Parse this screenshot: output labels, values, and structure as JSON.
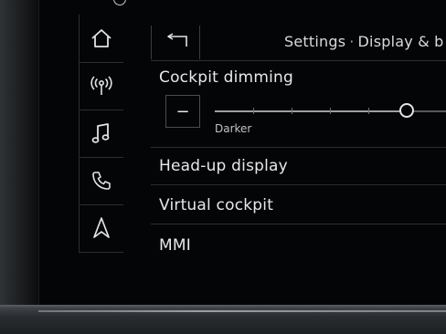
{
  "header": {
    "back_icon": "back-arrow-icon",
    "breadcrumb_root": "Settings",
    "breadcrumb_separator": "·",
    "breadcrumb_current": "Display & b"
  },
  "sidebar": {
    "items": [
      {
        "icon": "home-icon"
      },
      {
        "icon": "radio-antenna-icon"
      },
      {
        "icon": "music-note-icon"
      },
      {
        "icon": "phone-icon"
      },
      {
        "icon": "navigation-arrow-icon"
      }
    ]
  },
  "cockpit_dimming": {
    "label": "Cockpit dimming",
    "minus_label": "−",
    "caption": "Darker",
    "level": 0.83
  },
  "menu": {
    "items": [
      {
        "label": "Head-up display"
      },
      {
        "label": "Virtual cockpit"
      },
      {
        "label": "MMI"
      }
    ]
  }
}
